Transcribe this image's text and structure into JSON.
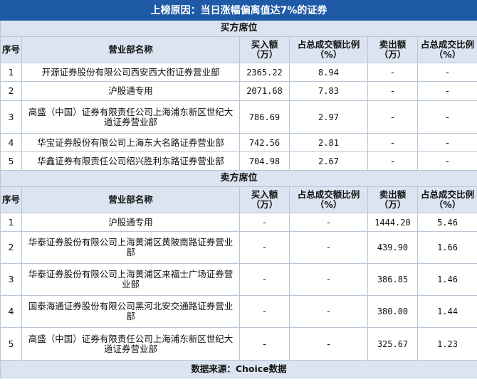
{
  "title": "上榜原因：当日涨幅偏离值达7%的证券",
  "buy_section": {
    "label": "买方席位",
    "headers": [
      "序号",
      "营业部名称",
      "买入额（万）",
      "占总成交额比例（%）",
      "卖出额（万）",
      "占总成交比例（%）"
    ],
    "rows": [
      {
        "no": "1",
        "name": "开源证券股份有限公司西安西大街证券营业部",
        "buy": "2365.22",
        "buy_pct": "8.94",
        "sell": "-",
        "sell_pct": "-"
      },
      {
        "no": "2",
        "name": "沪股通专用",
        "buy": "2071.68",
        "buy_pct": "7.83",
        "sell": "-",
        "sell_pct": "-"
      },
      {
        "no": "3",
        "name": "高盛（中国）证券有限责任公司上海浦东新区世纪大道证券营业部",
        "buy": "786.69",
        "buy_pct": "2.97",
        "sell": "-",
        "sell_pct": "-"
      },
      {
        "no": "4",
        "name": "华宝证券股份有限公司上海东大名路证券营业部",
        "buy": "742.56",
        "buy_pct": "2.81",
        "sell": "-",
        "sell_pct": "-"
      },
      {
        "no": "5",
        "name": "华鑫证券有限责任公司绍兴胜利东路证券营业部",
        "buy": "704.98",
        "buy_pct": "2.67",
        "sell": "-",
        "sell_pct": "-"
      }
    ]
  },
  "sell_section": {
    "label": "卖方席位",
    "headers": [
      "序号",
      "营业部名称",
      "买入额（万）",
      "占总成交额比例（%）",
      "卖出额（万）",
      "占总成交比例（%）"
    ],
    "rows": [
      {
        "no": "1",
        "name": "沪股通专用",
        "buy": "-",
        "buy_pct": "-",
        "sell": "1444.20",
        "sell_pct": "5.46"
      },
      {
        "no": "2",
        "name": "华泰证券股份有限公司上海黄浦区黄陂南路证券营业部",
        "buy": "-",
        "buy_pct": "-",
        "sell": "439.90",
        "sell_pct": "1.66"
      },
      {
        "no": "3",
        "name": "华泰证券股份有限公司上海黄浦区来福士广场证券营业部",
        "buy": "-",
        "buy_pct": "-",
        "sell": "386.85",
        "sell_pct": "1.46"
      },
      {
        "no": "4",
        "name": "国泰海通证券股份有限公司黑河北安交通路证券营业部",
        "buy": "-",
        "buy_pct": "-",
        "sell": "380.00",
        "sell_pct": "1.44"
      },
      {
        "no": "5",
        "name": "高盛（中国）证券有限责任公司上海浦东新区世纪大道证券营业部",
        "buy": "-",
        "buy_pct": "-",
        "sell": "325.67",
        "sell_pct": "1.23"
      }
    ]
  },
  "footer": "数据来源：Choice数据"
}
